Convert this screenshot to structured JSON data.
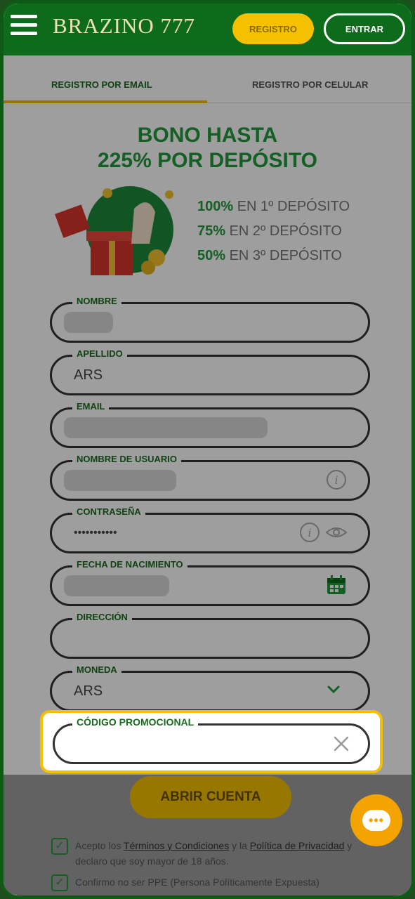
{
  "header": {
    "logo": "BRAZINO 777",
    "register_label": "REGISTRO",
    "login_label": "ENTRAR"
  },
  "tabs": {
    "email": "REGISTRO POR EMAIL",
    "phone": "REGISTRO POR CELULAR"
  },
  "bonus": {
    "title_line1": "BONO HASTA",
    "title_line2": "225% POR DEPÓSITO",
    "lines": [
      {
        "pct": "100%",
        "text": " EN 1º DEPÓSITO"
      },
      {
        "pct": "75%",
        "text": " EN 2º DEPÓSITO"
      },
      {
        "pct": "50%",
        "text": " EN 3º DEPÓSITO"
      }
    ]
  },
  "form": {
    "nombre_label": "NOMBRE",
    "apellido_label": "APELLIDO",
    "apellido_value": "ARS",
    "email_label": "EMAIL",
    "usuario_label": "NOMBRE DE USUARIO",
    "password_label": "CONTRASEÑA",
    "password_value": "•••••••••••",
    "fecha_label": "FECHA DE NACIMIENTO",
    "direccion_label": "DIRECCIÓN",
    "moneda_label": "MONEDA",
    "moneda_value": "ARS",
    "promo_label": "CÓDIGO PROMOCIONAL",
    "promo_value": ""
  },
  "submit_label": "ABRIR CUENTA",
  "terms": {
    "prefix": "Acepto los ",
    "terms_link": "Términos y Condiciones",
    "middle": " y la ",
    "privacy_link": "Política de Privacidad",
    "suffix": " y declaro que soy mayor de 18 años."
  },
  "ppe_text": "Confirmo no ser PPE (Persona Políticamente Expuesta)",
  "colors": {
    "brand_green": "#0f6b1c",
    "accent_yellow": "#f4c000"
  }
}
